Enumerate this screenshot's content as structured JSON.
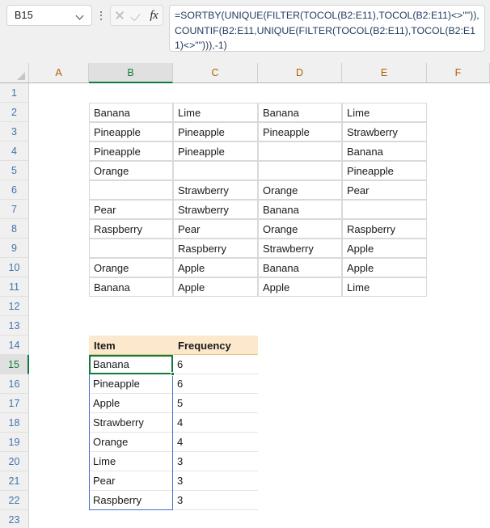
{
  "app": "Microsoft Excel",
  "formula_bar": {
    "name_box_value": "B15",
    "name_box_placeholder": "Name Box",
    "cancel_icon": "x-icon",
    "enter_icon": "check-icon",
    "insert_function_icon": "fx-icon",
    "insert_function_label": "fx",
    "formula": "=SORTBY(UNIQUE(FILTER(TOCOL(B2:E11),TOCOL(B2:E11)<>\"\")),COUNTIF(B2:E11,UNIQUE(FILTER(TOCOL(B2:E11),TOCOL(B2:E11)<>\"\"))),-1)"
  },
  "grid": {
    "columns": [
      "A",
      "B",
      "C",
      "D",
      "E",
      "F"
    ],
    "selected_column": "B",
    "rows": [
      "1",
      "2",
      "3",
      "4",
      "5",
      "6",
      "7",
      "8",
      "9",
      "10",
      "11",
      "12",
      "13",
      "14",
      "15",
      "16",
      "17",
      "18",
      "19",
      "20",
      "21",
      "22",
      "23"
    ],
    "selected_row": "15",
    "active_cell": "B15",
    "spill_range": "B15:B22",
    "accent_color": "#107c41",
    "spill_border_color": "#4472c4",
    "header_fill_color": "#fce9cd"
  },
  "source_table": {
    "range": "B2:E11",
    "columns": [
      "B",
      "C",
      "D",
      "E"
    ],
    "rows": [
      {
        "row": "2",
        "values": [
          "Banana",
          "Lime",
          "Banana",
          "Lime"
        ]
      },
      {
        "row": "3",
        "values": [
          "Pineapple",
          "Pineapple",
          "Pineapple",
          "Strawberry"
        ]
      },
      {
        "row": "4",
        "values": [
          "Pineapple",
          "Pineapple",
          "",
          "Banana"
        ]
      },
      {
        "row": "5",
        "values": [
          "Orange",
          "",
          "",
          "Pineapple"
        ]
      },
      {
        "row": "6",
        "values": [
          "",
          "Strawberry",
          "Orange",
          "Pear"
        ]
      },
      {
        "row": "7",
        "values": [
          "Pear",
          "Strawberry",
          "Banana",
          ""
        ]
      },
      {
        "row": "8",
        "values": [
          "Raspberry",
          "Pear",
          "Orange",
          "Raspberry"
        ]
      },
      {
        "row": "9",
        "values": [
          "",
          "Raspberry",
          "Strawberry",
          "Apple"
        ]
      },
      {
        "row": "10",
        "values": [
          "Orange",
          "Apple",
          "Banana",
          "Apple"
        ]
      },
      {
        "row": "11",
        "values": [
          "Banana",
          "Apple",
          "Apple",
          "Lime"
        ]
      }
    ]
  },
  "result_table": {
    "range": "B14:C22",
    "header_row": "14",
    "headers": [
      "Item",
      "Frequency"
    ],
    "rows": [
      {
        "row": "15",
        "item": "Banana",
        "frequency": "6"
      },
      {
        "row": "16",
        "item": "Pineapple",
        "frequency": "6"
      },
      {
        "row": "17",
        "item": "Apple",
        "frequency": "5"
      },
      {
        "row": "18",
        "item": "Strawberry",
        "frequency": "4"
      },
      {
        "row": "19",
        "item": "Orange",
        "frequency": "4"
      },
      {
        "row": "20",
        "item": "Lime",
        "frequency": "3"
      },
      {
        "row": "21",
        "item": "Pear",
        "frequency": "3"
      },
      {
        "row": "22",
        "item": "Raspberry",
        "frequency": "3"
      }
    ]
  }
}
